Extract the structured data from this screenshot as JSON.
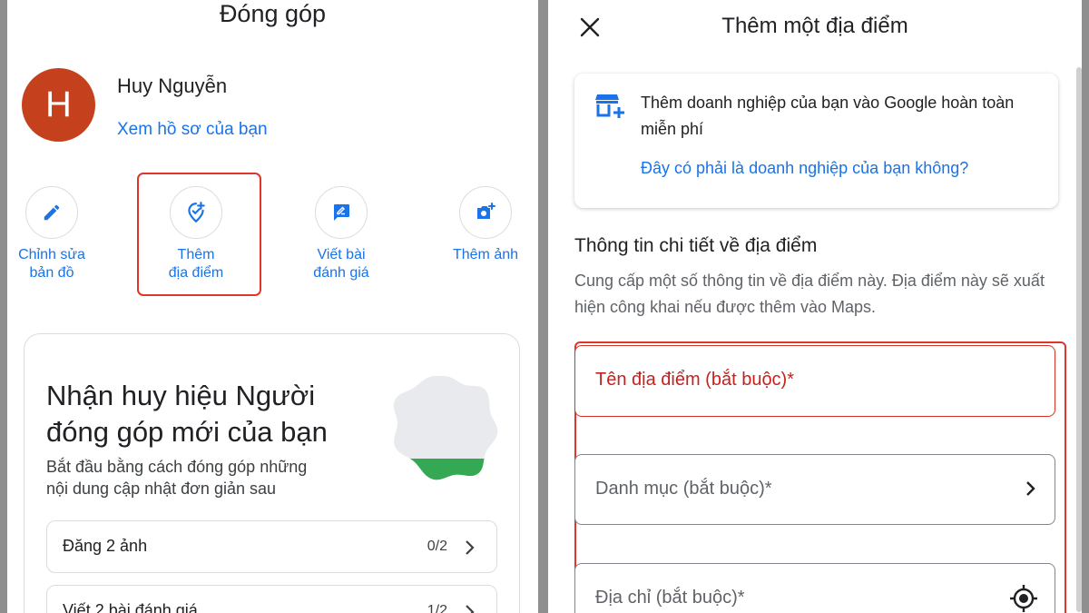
{
  "left": {
    "title": "Đóng góp",
    "avatar_letter": "H",
    "user_name": "Huy Nguyễn",
    "profile_link": "Xem hồ sơ của bạn",
    "actions": [
      {
        "label": "Chỉnh sửa\nbản đồ",
        "icon": "pencil-icon"
      },
      {
        "label": "Thêm\nđịa điểm",
        "icon": "add-place-icon"
      },
      {
        "label": "Viết bài\nđánh giá",
        "icon": "review-icon"
      },
      {
        "label": "Thêm ảnh",
        "icon": "add-photo-icon"
      }
    ],
    "badge": {
      "title": "Nhận huy hiệu Người\nđóng góp mới của bạn",
      "desc": "Bắt đầu bằng cách đóng góp những\nnội dung cập nhật đơn giản sau"
    },
    "tasks": [
      {
        "label": "Đăng 2 ảnh",
        "count": "0/2"
      },
      {
        "label": "Viết 2 bài đánh giá",
        "count": "1/2"
      }
    ]
  },
  "right": {
    "title": "Thêm một địa điểm",
    "biz_text": "Thêm doanh nghiệp của bạn vào Google hoàn toàn miễn phí",
    "biz_link": "Đây có phải là doanh nghiệp của bạn không?",
    "section_title": "Thông tin chi tiết về địa điểm",
    "section_desc": "Cung cấp một số thông tin về địa điểm này. Địa điểm này sẽ xuất hiện công khai nếu được thêm vào Maps.",
    "fields": [
      {
        "placeholder": "Tên địa điểm (bắt buộc)*"
      },
      {
        "placeholder": "Danh mục (bắt buộc)*"
      },
      {
        "placeholder": "Địa chỉ (bắt buộc)*"
      }
    ]
  },
  "colors": {
    "accent": "#1a73e8",
    "avatar": "#c5401c",
    "highlight": "#e0352b",
    "badge_green": "#34a853"
  }
}
